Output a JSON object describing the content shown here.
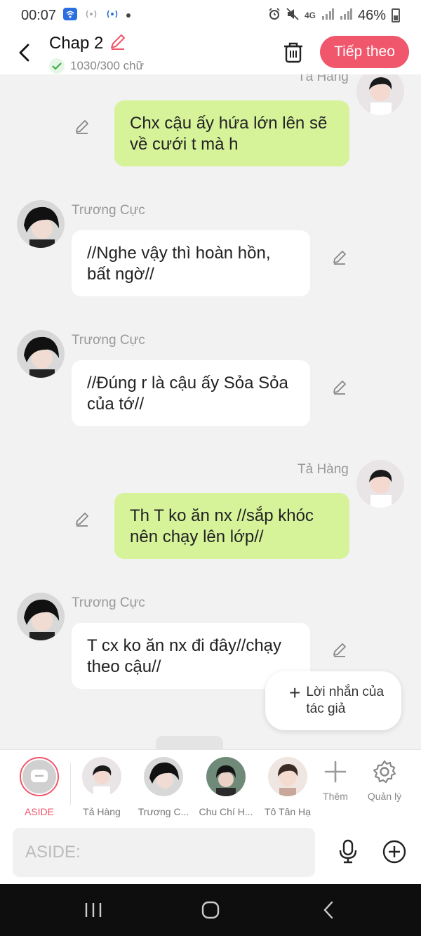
{
  "status_bar": {
    "time": "00:07",
    "network": "4G",
    "battery": "46%",
    "icons": [
      "wifi-hotspot-icon",
      "hotspot-icon",
      "wifi-icon",
      "alarm-icon",
      "mute-icon",
      "signal-icon",
      "battery-icon"
    ]
  },
  "header": {
    "title": "Chap 2",
    "word_count": "1030/300 chữ",
    "next_label": "Tiếp theo",
    "colors": {
      "accent": "#f0566c",
      "right_bubble": "#d6f39a"
    }
  },
  "messages": [
    {
      "side": "right",
      "sender": "Tả Hàng",
      "text": "Chx cậu ấy hứa lớn lên sẽ về cưới t mà h"
    },
    {
      "side": "left",
      "sender": "Trương Cực",
      "text": "//Nghe vậy thì hoàn hồn, bất ngờ//"
    },
    {
      "side": "left",
      "sender": "Trương Cực",
      "text": "//Đúng r là cậu ấy Sỏa Sỏa của tớ//"
    },
    {
      "side": "right",
      "sender": "Tả Hàng",
      "text": "Th T ko ăn nx //sắp khóc nên chạy lên lớp//"
    },
    {
      "side": "left",
      "sender": "Trương Cực",
      "text": "T cx ko ăn nx đi đây//chạy theo cậu//"
    }
  ],
  "author_note": {
    "label": "Lời nhắn của tác giả"
  },
  "characters": [
    {
      "label": "ASIDE"
    },
    {
      "label": "Tả Hàng"
    },
    {
      "label": "Trương C..."
    },
    {
      "label": "Chu Chí H..."
    },
    {
      "label": "Tô Tân Hạ"
    }
  ],
  "tools": {
    "more_label": "Thêm",
    "manage_label": "Quản lý"
  },
  "input": {
    "placeholder": "ASIDE:"
  }
}
